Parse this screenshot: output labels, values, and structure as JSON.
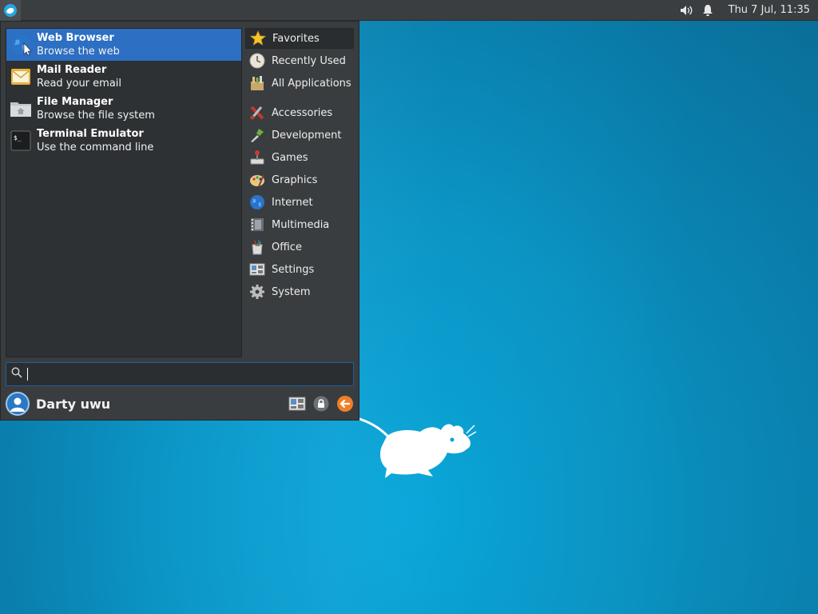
{
  "panel": {
    "clock": "Thu  7 Jul, 11:35"
  },
  "menu": {
    "favorites_apps": [
      {
        "name": "Web Browser",
        "desc": "Browse the web",
        "icon": "globe-icon"
      },
      {
        "name": "Mail Reader",
        "desc": "Read your email",
        "icon": "mail-icon"
      },
      {
        "name": "File Manager",
        "desc": "Browse the file system",
        "icon": "folder-icon"
      },
      {
        "name": "Terminal Emulator",
        "desc": "Use the command line",
        "icon": "terminal-icon"
      }
    ],
    "categories_top": [
      {
        "label": "Favorites",
        "icon": "star-icon"
      },
      {
        "label": "Recently Used",
        "icon": "clock-icon"
      },
      {
        "label": "All Applications",
        "icon": "applications-icon"
      }
    ],
    "categories": [
      {
        "label": "Accessories",
        "icon": "accessories-icon"
      },
      {
        "label": "Development",
        "icon": "development-icon"
      },
      {
        "label": "Games",
        "icon": "games-icon"
      },
      {
        "label": "Graphics",
        "icon": "graphics-icon"
      },
      {
        "label": "Internet",
        "icon": "internet-icon"
      },
      {
        "label": "Multimedia",
        "icon": "multimedia-icon"
      },
      {
        "label": "Office",
        "icon": "office-icon"
      },
      {
        "label": "Settings",
        "icon": "settings-icon"
      },
      {
        "label": "System",
        "icon": "system-icon"
      }
    ],
    "search": {
      "value": ""
    },
    "user": {
      "name": "Darty uwu"
    }
  },
  "colors": {
    "selection": "#2c6fc3",
    "panel_bg": "#3b3e40",
    "menu_bg": "#3a3d3f",
    "desktop": "#0aa9dd"
  }
}
